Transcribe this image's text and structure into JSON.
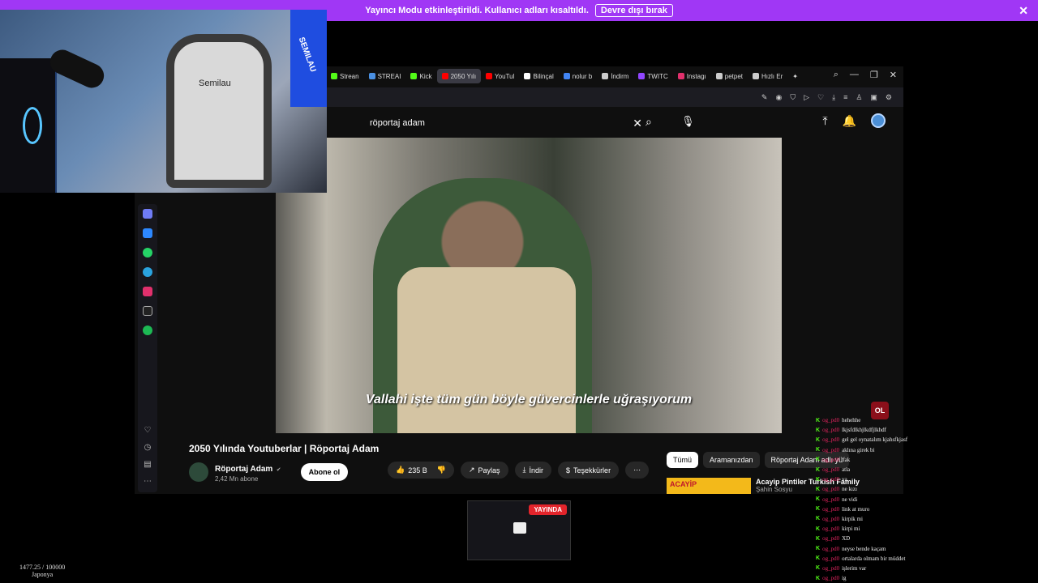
{
  "banner": {
    "message": "Yayıncı Modu etkinleştirildi. Kullanıcı adları kısaltıldı.",
    "button": "Devre dışı bırak",
    "close": "✕"
  },
  "webcam": {
    "chair_brand": "Semilau",
    "light_text": "SEMILAU"
  },
  "browser": {
    "tabs": [
      {
        "label": "Strean",
        "color": "#53fc18"
      },
      {
        "label": "STREAI",
        "color": "#4a90e2"
      },
      {
        "label": "Kick",
        "color": "#53fc18"
      },
      {
        "label": "2050 Yılı",
        "color": "#ff0000"
      },
      {
        "label": "YouTul",
        "color": "#ff0000"
      },
      {
        "label": "Bilinçal",
        "color": "#ffffff"
      },
      {
        "label": "nolur b",
        "color": "#4285f4"
      },
      {
        "label": "İndirm",
        "color": "#cccccc"
      },
      {
        "label": "TWITC",
        "color": "#9146ff"
      },
      {
        "label": "Instagı",
        "color": "#e1306c"
      },
      {
        "label": "petpet",
        "color": "#cccccc"
      },
      {
        "label": "Hızlı Er",
        "color": "#cccccc"
      }
    ],
    "window_controls": {
      "search": "⌕",
      "minimize": "—",
      "restore": "❐",
      "close": "✕"
    }
  },
  "youtube": {
    "search_query": "röportaj adam",
    "video": {
      "subtitle": "Vallahi işte tüm gün böyle güvercinlerle uğraşıyorum",
      "title": "2050 Yılında Youtuberlar | Röportaj Adam"
    },
    "channel": {
      "name": "Röportaj Adam",
      "verified": "✔",
      "subscribers": "2,42 Mn abone",
      "subscribe_label": "Abone ol"
    },
    "actions": {
      "likes": "235 B",
      "share": "Paylaş",
      "download": "İndir",
      "thanks": "Teşekkürler",
      "more": "⋯"
    },
    "chips": [
      "Tümü",
      "Aramanızdan",
      "Röportaj Adam adlı yü"
    ],
    "recommendation": {
      "thumb_text": "ACAYİP",
      "title": "Acayip Pintiler Turkish Family",
      "channel": "Şahin Sosyu"
    }
  },
  "mini_preview": {
    "live_label": "YAYINDA"
  },
  "counter": {
    "value": "1477.25 / 100000",
    "label": "Japonya"
  },
  "chat": {
    "badge": "OL",
    "messages": [
      {
        "user": "og_pd0",
        "text": "hehehhe"
      },
      {
        "user": "og_pd0",
        "text": "lkjsfdlkhjlkdfjlkhdf"
      },
      {
        "user": "og_pd0",
        "text": "gel gel oynatalım kjahsfkjasf"
      },
      {
        "user": "og_pd0",
        "text": "aklına girek bi"
      },
      {
        "user": "og_pd0",
        "text": "'fak"
      },
      {
        "user": "og_pd0",
        "text": "atla"
      },
      {
        "user": "og_pd0",
        "text": "ya"
      },
      {
        "user": "og_pd0",
        "text": "ne kızı"
      },
      {
        "user": "og_pd0",
        "text": "ne vidi"
      },
      {
        "user": "og_pd0",
        "text": "link at muro"
      },
      {
        "user": "og_pd0",
        "text": "kirpik mi"
      },
      {
        "user": "og_pd0",
        "text": "kirpi mi"
      },
      {
        "user": "og_pd0",
        "text": "XD"
      },
      {
        "user": "og_pd0",
        "text": "neyse bende kaçam"
      },
      {
        "user": "og_pd0",
        "text": "ortalarda olmam bir müddet"
      },
      {
        "user": "og_pd0",
        "text": "işlerim var"
      },
      {
        "user": "og_pd0",
        "text": "ig"
      }
    ]
  }
}
